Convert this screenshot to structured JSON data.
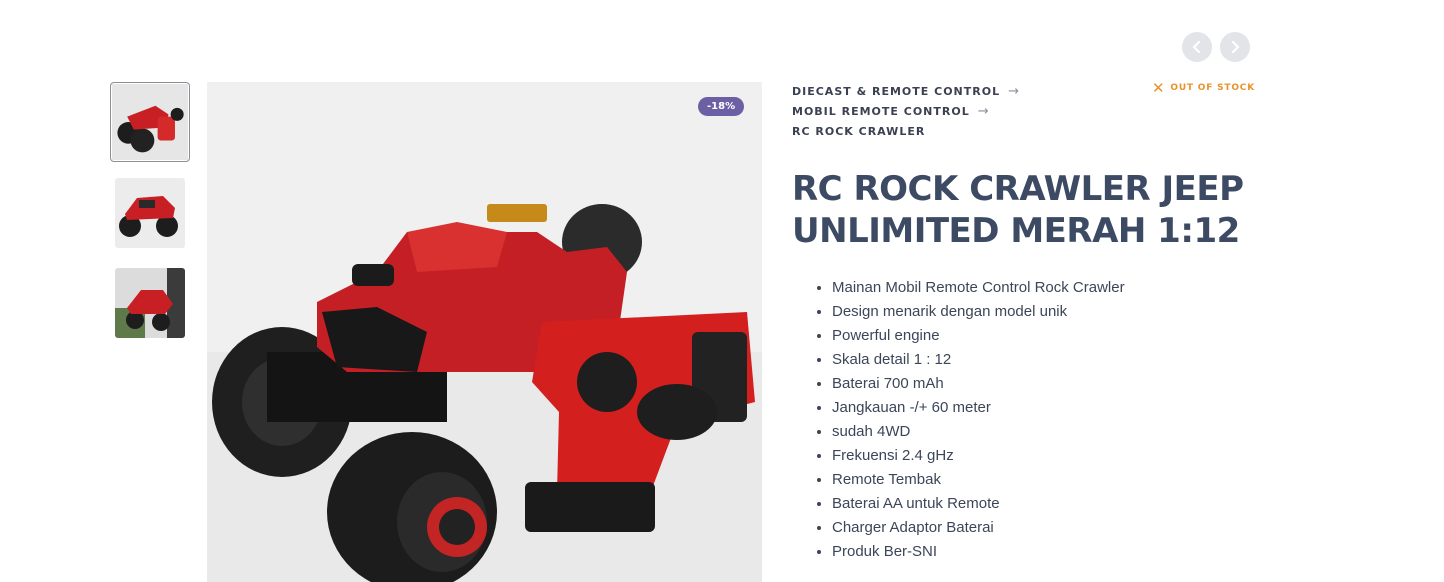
{
  "navigation": {
    "prev_icon": "chevron-left-icon",
    "next_icon": "chevron-right-icon"
  },
  "gallery": {
    "thumbnails": [
      {
        "label": "thumbnail-1",
        "active": true
      },
      {
        "label": "thumbnail-2",
        "active": false
      },
      {
        "label": "thumbnail-3",
        "active": false
      }
    ],
    "discount_badge": "-18%"
  },
  "breadcrumbs": [
    {
      "label": "DIECAST & REMOTE CONTROL",
      "arrow": "→"
    },
    {
      "label": "MOBIL REMOTE CONTROL",
      "arrow": "→"
    },
    {
      "label": "RC ROCK CRAWLER",
      "arrow": ""
    }
  ],
  "stock": {
    "icon": "x-icon",
    "label": "OUT OF STOCK",
    "color": "#e8932a"
  },
  "product": {
    "title_line1": "RC ROCK CRAWLER JEEP",
    "title_line2": "UNLIMITED MERAH 1:12",
    "features": [
      "Mainan Mobil Remote Control Rock Crawler",
      "Design menarik dengan model unik",
      "Powerful engine",
      "Skala detail 1 : 12",
      "Baterai 700 mAh",
      "Jangkauan -/+ 60 meter",
      "sudah 4WD",
      "Frekuensi 2.4 gHz",
      "Remote Tembak",
      "Baterai AA untuk Remote",
      "Charger Adaptor Baterai",
      "Produk Ber-SNI"
    ]
  },
  "colors": {
    "badge": "#6d5fa3",
    "title": "#3d4a64",
    "accent_red": "#d62b2b"
  }
}
